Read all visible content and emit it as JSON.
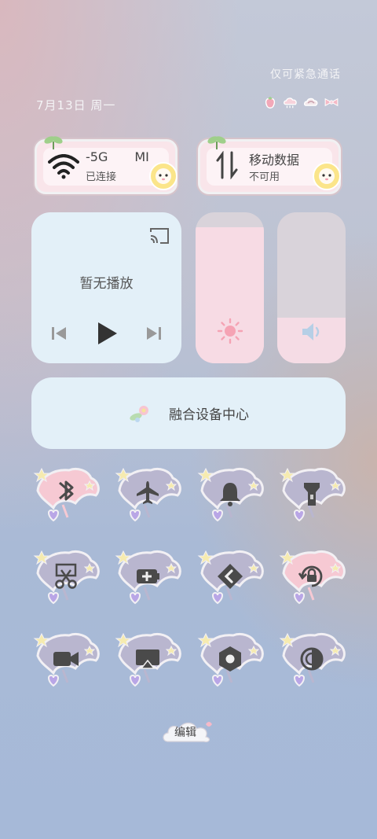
{
  "status": {
    "emergency_text": "仅可紧急通话",
    "date_text": "7月13日 周一",
    "icons": [
      "strawberry-icon",
      "cloud-signal-icon",
      "wifi-cloud-icon",
      "bow-icon"
    ]
  },
  "network": {
    "wifi": {
      "title": "-5G",
      "title_tail": "MI",
      "subtitle": "已连接"
    },
    "mobile": {
      "title": "移动数据",
      "subtitle": "不可用"
    }
  },
  "media": {
    "now_playing": "暂无播放"
  },
  "sliders": {
    "brightness_level": 0.9,
    "volume_level": 0.3
  },
  "device_center": {
    "label": "融合设备中心"
  },
  "toggles": [
    {
      "name": "bluetooth",
      "icon": "bluetooth-icon",
      "active": true
    },
    {
      "name": "airplane",
      "icon": "airplane-icon",
      "active": false
    },
    {
      "name": "bell",
      "icon": "bell-icon",
      "active": false
    },
    {
      "name": "flashlight",
      "icon": "flashlight-icon",
      "active": false
    },
    {
      "name": "screenshot",
      "icon": "scissors-icon",
      "active": false
    },
    {
      "name": "power-saving",
      "icon": "battery-plus-icon",
      "active": false
    },
    {
      "name": "code",
      "icon": "chevron-code-icon",
      "active": false
    },
    {
      "name": "rotation-lock",
      "icon": "rotation-lock-icon",
      "active": true
    },
    {
      "name": "screen-record",
      "icon": "video-camera-icon",
      "active": false
    },
    {
      "name": "screen-cast",
      "icon": "screen-cast-icon",
      "active": false
    },
    {
      "name": "settings",
      "icon": "hexagon-gear-icon",
      "active": false
    },
    {
      "name": "dark-mode",
      "icon": "contrast-icon",
      "active": false
    }
  ],
  "edit": {
    "label": "编辑"
  },
  "colors": {
    "active_umbrella": "#f6c9d3",
    "inactive_umbrella": "#b9b6cf",
    "card_bg": "#e3f0f8",
    "slider_fill": "#f7dbe4",
    "glyph": "#4a4a4a"
  }
}
